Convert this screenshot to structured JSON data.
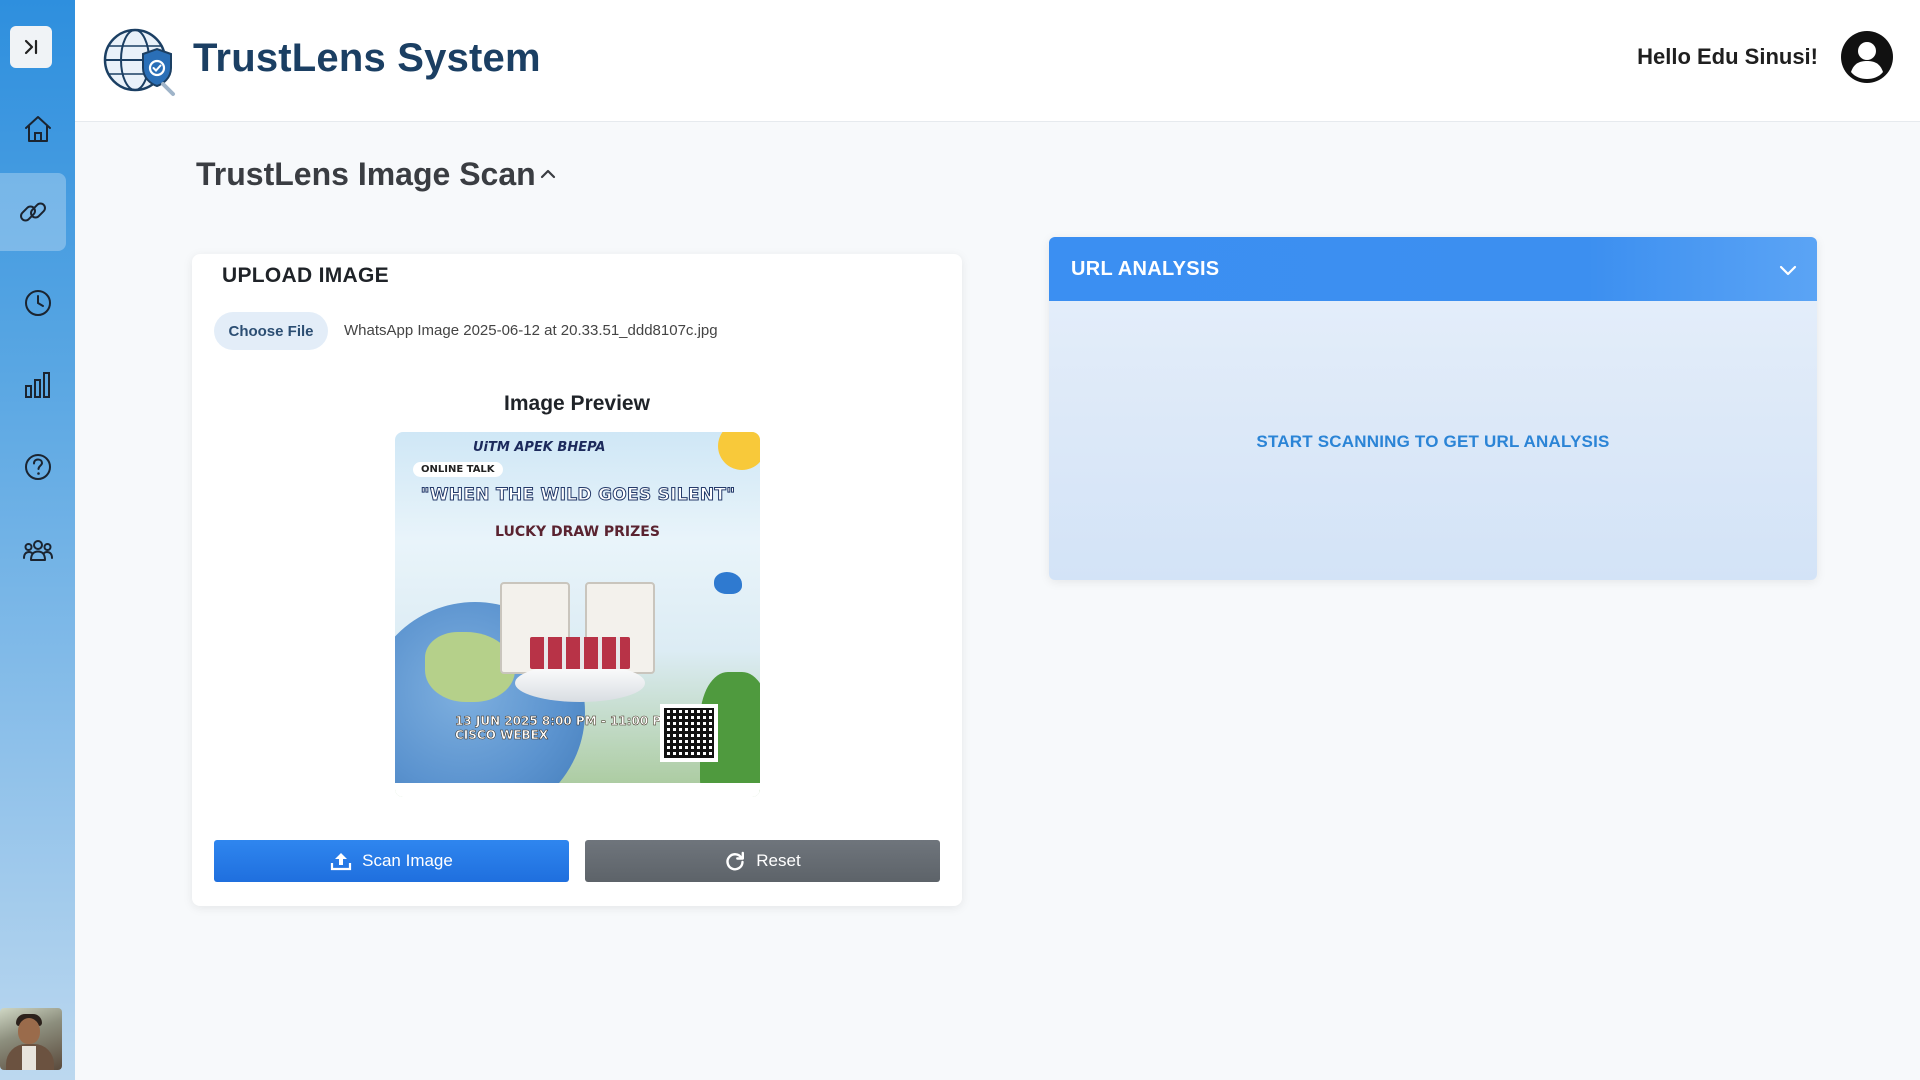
{
  "app": {
    "title": "TrustLens System",
    "greeting": "Hello Edu Sinusi!"
  },
  "sidebar": {
    "items": [
      {
        "name": "home",
        "icon": "home-icon",
        "active": false
      },
      {
        "name": "url-scan",
        "icon": "link-icon",
        "active": true
      },
      {
        "name": "history",
        "icon": "clock-icon",
        "active": false
      },
      {
        "name": "analytics",
        "icon": "bar-chart-icon",
        "active": false
      },
      {
        "name": "help",
        "icon": "question-icon",
        "active": false
      },
      {
        "name": "team",
        "icon": "users-icon",
        "active": false
      }
    ]
  },
  "page": {
    "section_title": "TrustLens Image Scan"
  },
  "upload": {
    "title": "UPLOAD IMAGE",
    "choose_file_label": "Choose File",
    "file_name": "WhatsApp Image 2025-06-12 at 20.33.51_ddd8107c.jpg",
    "preview_label": "Image Preview",
    "poster": {
      "tag": "ONLINE TALK",
      "logos": "UiTM  APEK  BHEPA",
      "headline": "\"WHEN THE WILD GOES SILENT\"",
      "subheadline": "LUCKY DRAW PRIZES",
      "date": "13 JUN 2025   8:00 PM - 11:00 PM   CISCO WEBEX"
    },
    "scan_label": "Scan Image",
    "reset_label": "Reset"
  },
  "url_analysis": {
    "title": "URL ANALYSIS",
    "empty_message": "START SCANNING TO GET URL ANALYSIS"
  },
  "colors": {
    "accent": "#2f86ef",
    "title": "#1b3f63",
    "panel_header": "#3b8ff2",
    "reset": "#676d73"
  }
}
